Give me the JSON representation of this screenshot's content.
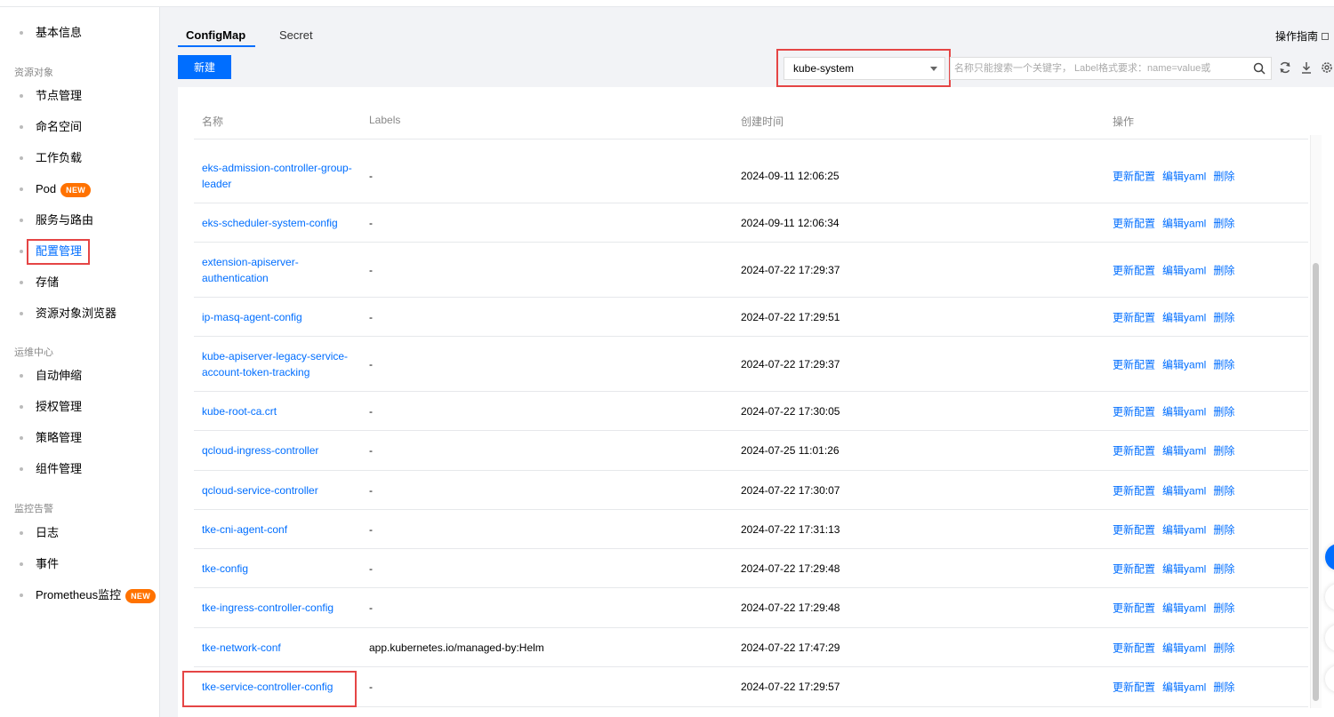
{
  "sidebar": {
    "top_item": "基本信息",
    "sections": [
      {
        "label": "资源对象"
      },
      {
        "label": "运维中心"
      },
      {
        "label": "监控告警"
      }
    ],
    "resource_items": [
      "节点管理",
      "命名空间",
      "工作负载",
      "Pod",
      "服务与路由",
      "配置管理",
      "存储",
      "资源对象浏览器"
    ],
    "ops_items": [
      "自动伸缩",
      "授权管理",
      "策略管理",
      "组件管理"
    ],
    "monitor_items": [
      "日志",
      "事件",
      "Prometheus监控"
    ],
    "badge_new": "NEW",
    "active_item": "配置管理"
  },
  "tabs": [
    {
      "label": "ConfigMap",
      "active": true
    },
    {
      "label": "Secret",
      "active": false
    }
  ],
  "guide_link": "操作指南",
  "toolbar": {
    "new_button": "新建",
    "namespace": "kube-system",
    "search_placeholder": "名称只能搜索一个关键字， Label格式要求：name=value或"
  },
  "table": {
    "columns": [
      "名称",
      "Labels",
      "创建时间",
      "操作"
    ],
    "ops": [
      "更新配置",
      "编辑yaml",
      "删除"
    ],
    "rows": [
      {
        "name": "eks-admission-controller-group-leader",
        "labels": "-",
        "time": "2024-09-11 12:06:25"
      },
      {
        "name": "eks-scheduler-system-config",
        "labels": "-",
        "time": "2024-09-11 12:06:34"
      },
      {
        "name": "extension-apiserver-authentication",
        "labels": "-",
        "time": "2024-07-22 17:29:37"
      },
      {
        "name": "ip-masq-agent-config",
        "labels": "-",
        "time": "2024-07-22 17:29:51"
      },
      {
        "name": "kube-apiserver-legacy-service-account-token-tracking",
        "labels": "-",
        "time": "2024-07-22 17:29:37"
      },
      {
        "name": "kube-root-ca.crt",
        "labels": "-",
        "time": "2024-07-22 17:30:05"
      },
      {
        "name": "qcloud-ingress-controller",
        "labels": "-",
        "time": "2024-07-25 11:01:26"
      },
      {
        "name": "qcloud-service-controller",
        "labels": "-",
        "time": "2024-07-22 17:30:07"
      },
      {
        "name": "tke-cni-agent-conf",
        "labels": "-",
        "time": "2024-07-22 17:31:13"
      },
      {
        "name": "tke-config",
        "labels": "-",
        "time": "2024-07-22 17:29:48"
      },
      {
        "name": "tke-ingress-controller-config",
        "labels": "-",
        "time": "2024-07-22 17:29:48"
      },
      {
        "name": "tke-network-conf",
        "labels": "app.kubernetes.io/managed-by:Helm",
        "time": "2024-07-22 17:47:29"
      },
      {
        "name": "tke-service-controller-config",
        "labels": "-",
        "time": "2024-07-22 17:29:57"
      }
    ]
  },
  "colors": {
    "accent": "#006eff",
    "highlight": "#e54545",
    "badge": "#ff7200"
  }
}
